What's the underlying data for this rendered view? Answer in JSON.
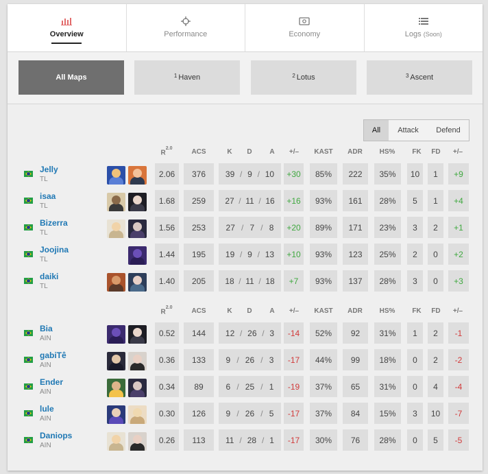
{
  "tabs": [
    {
      "label": "Overview",
      "icon": "bar-chart-icon",
      "active": true
    },
    {
      "label": "Performance",
      "icon": "crosshair-icon",
      "active": false
    },
    {
      "label": "Economy",
      "icon": "money-icon",
      "active": false
    },
    {
      "label": "Logs",
      "soon": "(Soon)",
      "icon": "list-icon",
      "active": false
    }
  ],
  "maps": [
    {
      "label": "All Maps",
      "num": "",
      "active": true
    },
    {
      "label": "Haven",
      "num": "1",
      "active": false
    },
    {
      "label": "Lotus",
      "num": "2",
      "active": false
    },
    {
      "label": "Ascent",
      "num": "3",
      "active": false
    }
  ],
  "side_filter": {
    "options": [
      "All",
      "Attack",
      "Defend"
    ],
    "selected": "All"
  },
  "columns": {
    "rating": "R",
    "rating_sup": "2.0",
    "acs": "ACS",
    "k": "K",
    "d": "D",
    "a": "A",
    "pm": "+/–",
    "kast": "KAST",
    "adr": "ADR",
    "hs": "HS%",
    "fk": "FK",
    "fd": "FD",
    "fkpm": "+/–"
  },
  "colors": {
    "accent_active_tab": "#222222",
    "player_link": "#1f78b4",
    "positive": "#3fa83f",
    "negative": "#d23a3a"
  },
  "teams": [
    {
      "players": [
        {
          "name": "Jelly",
          "team": "TL",
          "agents": [
            "agent-1",
            "agent-2"
          ],
          "rating": "2.06",
          "acs": "376",
          "k": "39",
          "d": "9",
          "a": "10",
          "pm": "+30",
          "kast": "85%",
          "adr": "222",
          "hs": "35%",
          "fk": "10",
          "fd": "1",
          "fkpm": "+9"
        },
        {
          "name": "isaa",
          "team": "TL",
          "agents": [
            "agent-3",
            "agent-4"
          ],
          "rating": "1.68",
          "acs": "259",
          "k": "27",
          "d": "11",
          "a": "16",
          "pm": "+16",
          "kast": "93%",
          "adr": "161",
          "hs": "28%",
          "fk": "5",
          "fd": "1",
          "fkpm": "+4"
        },
        {
          "name": "Bizerra",
          "team": "TL",
          "agents": [
            "agent-5",
            "agent-6"
          ],
          "rating": "1.56",
          "acs": "253",
          "k": "27",
          "d": "7",
          "a": "8",
          "pm": "+20",
          "kast": "89%",
          "adr": "171",
          "hs": "23%",
          "fk": "3",
          "fd": "2",
          "fkpm": "+1"
        },
        {
          "name": "Joojina",
          "team": "TL",
          "agents": [
            "agent-7"
          ],
          "rating": "1.44",
          "acs": "195",
          "k": "19",
          "d": "9",
          "a": "13",
          "pm": "+10",
          "kast": "93%",
          "adr": "123",
          "hs": "25%",
          "fk": "2",
          "fd": "0",
          "fkpm": "+2"
        },
        {
          "name": "daiki",
          "team": "TL",
          "agents": [
            "agent-8",
            "agent-9"
          ],
          "rating": "1.40",
          "acs": "205",
          "k": "18",
          "d": "11",
          "a": "18",
          "pm": "+7",
          "kast": "93%",
          "adr": "137",
          "hs": "28%",
          "fk": "3",
          "fd": "0",
          "fkpm": "+3"
        }
      ]
    },
    {
      "players": [
        {
          "name": "Bia",
          "team": "AIN",
          "agents": [
            "agent-7",
            "agent-4"
          ],
          "rating": "0.52",
          "acs": "144",
          "k": "12",
          "d": "26",
          "a": "3",
          "pm": "-14",
          "kast": "52%",
          "adr": "92",
          "hs": "31%",
          "fk": "1",
          "fd": "2",
          "fkpm": "-1"
        },
        {
          "name": "gabiTê",
          "team": "AIN",
          "agents": [
            "agent-10",
            "agent-11"
          ],
          "rating": "0.36",
          "acs": "133",
          "k": "9",
          "d": "26",
          "a": "3",
          "pm": "-17",
          "kast": "44%",
          "adr": "99",
          "hs": "18%",
          "fk": "0",
          "fd": "2",
          "fkpm": "-2"
        },
        {
          "name": "Ender",
          "team": "AIN",
          "agents": [
            "agent-12",
            "agent-6"
          ],
          "rating": "0.34",
          "acs": "89",
          "k": "6",
          "d": "25",
          "a": "1",
          "pm": "-19",
          "kast": "37%",
          "adr": "65",
          "hs": "31%",
          "fk": "0",
          "fd": "4",
          "fkpm": "-4"
        },
        {
          "name": "lule",
          "team": "AIN",
          "agents": [
            "agent-13",
            "agent-14"
          ],
          "rating": "0.30",
          "acs": "126",
          "k": "9",
          "d": "26",
          "a": "5",
          "pm": "-17",
          "kast": "37%",
          "adr": "84",
          "hs": "15%",
          "fk": "3",
          "fd": "10",
          "fkpm": "-7"
        },
        {
          "name": "Daniops",
          "team": "AIN",
          "agents": [
            "agent-5",
            "agent-11"
          ],
          "rating": "0.26",
          "acs": "113",
          "k": "11",
          "d": "28",
          "a": "1",
          "pm": "-17",
          "kast": "30%",
          "adr": "76",
          "hs": "28%",
          "fk": "0",
          "fd": "5",
          "fkpm": "-5"
        }
      ]
    }
  ]
}
